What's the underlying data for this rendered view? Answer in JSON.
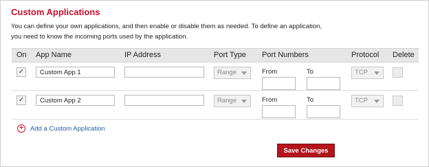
{
  "section": {
    "title": "Custom Applications",
    "description_line1": "You can define your own applications, and then enable or disable them as needed. To define an application,",
    "description_line2": "you need to know the incoming ports used by the application."
  },
  "table": {
    "headers": {
      "on": "On",
      "app_name": "App Name",
      "ip_address": "IP Address",
      "port_type": "Port Type",
      "port_numbers": "Port Numbers",
      "protocol": "Protocol",
      "delete": "Delete"
    },
    "from_label": "From",
    "to_label": "To",
    "rows": [
      {
        "on_checked": "✓",
        "app_name": "Custom App 1",
        "ip_address": "",
        "port_type": "Range",
        "port_from": "",
        "port_to": "",
        "protocol": "TCP"
      },
      {
        "on_checked": "✓",
        "app_name": "Custom App 2",
        "ip_address": "",
        "port_type": "Range",
        "port_from": "",
        "port_to": "",
        "protocol": "TCP"
      }
    ]
  },
  "add_link": {
    "icon": "plus-circle-icon",
    "icon_glyph": "+",
    "label": "Add a Custom Application"
  },
  "save_button": {
    "label": "Save Changes"
  },
  "colors": {
    "title_red": "#c8102e",
    "button_red": "#b3151c",
    "link_blue": "#1d5f9e",
    "header_gray": "#e6e6e6"
  }
}
